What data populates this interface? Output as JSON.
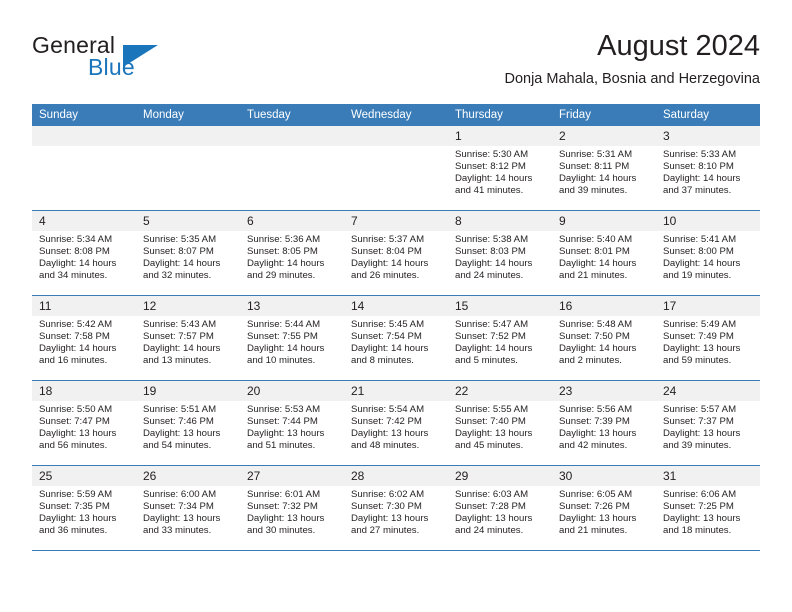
{
  "brand": {
    "word1": "General",
    "word2": "Blue",
    "accent_color": "#1b75bb"
  },
  "header": {
    "month_title": "August 2024",
    "location": "Donja Mahala, Bosnia and Herzegovina"
  },
  "calendar": {
    "header_color": "#3a7cb8",
    "weekdays": [
      "Sunday",
      "Monday",
      "Tuesday",
      "Wednesday",
      "Thursday",
      "Friday",
      "Saturday"
    ],
    "weeks": [
      [
        {
          "day": "",
          "sunrise": "",
          "sunset": "",
          "daylight": "",
          "empty": true
        },
        {
          "day": "",
          "sunrise": "",
          "sunset": "",
          "daylight": "",
          "empty": true
        },
        {
          "day": "",
          "sunrise": "",
          "sunset": "",
          "daylight": "",
          "empty": true
        },
        {
          "day": "",
          "sunrise": "",
          "sunset": "",
          "daylight": "",
          "empty": true
        },
        {
          "day": "1",
          "sunrise": "Sunrise: 5:30 AM",
          "sunset": "Sunset: 8:12 PM",
          "daylight": "Daylight: 14 hours and 41 minutes.",
          "empty": false
        },
        {
          "day": "2",
          "sunrise": "Sunrise: 5:31 AM",
          "sunset": "Sunset: 8:11 PM",
          "daylight": "Daylight: 14 hours and 39 minutes.",
          "empty": false
        },
        {
          "day": "3",
          "sunrise": "Sunrise: 5:33 AM",
          "sunset": "Sunset: 8:10 PM",
          "daylight": "Daylight: 14 hours and 37 minutes.",
          "empty": false
        }
      ],
      [
        {
          "day": "4",
          "sunrise": "Sunrise: 5:34 AM",
          "sunset": "Sunset: 8:08 PM",
          "daylight": "Daylight: 14 hours and 34 minutes.",
          "empty": false
        },
        {
          "day": "5",
          "sunrise": "Sunrise: 5:35 AM",
          "sunset": "Sunset: 8:07 PM",
          "daylight": "Daylight: 14 hours and 32 minutes.",
          "empty": false
        },
        {
          "day": "6",
          "sunrise": "Sunrise: 5:36 AM",
          "sunset": "Sunset: 8:05 PM",
          "daylight": "Daylight: 14 hours and 29 minutes.",
          "empty": false
        },
        {
          "day": "7",
          "sunrise": "Sunrise: 5:37 AM",
          "sunset": "Sunset: 8:04 PM",
          "daylight": "Daylight: 14 hours and 26 minutes.",
          "empty": false
        },
        {
          "day": "8",
          "sunrise": "Sunrise: 5:38 AM",
          "sunset": "Sunset: 8:03 PM",
          "daylight": "Daylight: 14 hours and 24 minutes.",
          "empty": false
        },
        {
          "day": "9",
          "sunrise": "Sunrise: 5:40 AM",
          "sunset": "Sunset: 8:01 PM",
          "daylight": "Daylight: 14 hours and 21 minutes.",
          "empty": false
        },
        {
          "day": "10",
          "sunrise": "Sunrise: 5:41 AM",
          "sunset": "Sunset: 8:00 PM",
          "daylight": "Daylight: 14 hours and 19 minutes.",
          "empty": false
        }
      ],
      [
        {
          "day": "11",
          "sunrise": "Sunrise: 5:42 AM",
          "sunset": "Sunset: 7:58 PM",
          "daylight": "Daylight: 14 hours and 16 minutes.",
          "empty": false
        },
        {
          "day": "12",
          "sunrise": "Sunrise: 5:43 AM",
          "sunset": "Sunset: 7:57 PM",
          "daylight": "Daylight: 14 hours and 13 minutes.",
          "empty": false
        },
        {
          "day": "13",
          "sunrise": "Sunrise: 5:44 AM",
          "sunset": "Sunset: 7:55 PM",
          "daylight": "Daylight: 14 hours and 10 minutes.",
          "empty": false
        },
        {
          "day": "14",
          "sunrise": "Sunrise: 5:45 AM",
          "sunset": "Sunset: 7:54 PM",
          "daylight": "Daylight: 14 hours and 8 minutes.",
          "empty": false
        },
        {
          "day": "15",
          "sunrise": "Sunrise: 5:47 AM",
          "sunset": "Sunset: 7:52 PM",
          "daylight": "Daylight: 14 hours and 5 minutes.",
          "empty": false
        },
        {
          "day": "16",
          "sunrise": "Sunrise: 5:48 AM",
          "sunset": "Sunset: 7:50 PM",
          "daylight": "Daylight: 14 hours and 2 minutes.",
          "empty": false
        },
        {
          "day": "17",
          "sunrise": "Sunrise: 5:49 AM",
          "sunset": "Sunset: 7:49 PM",
          "daylight": "Daylight: 13 hours and 59 minutes.",
          "empty": false
        }
      ],
      [
        {
          "day": "18",
          "sunrise": "Sunrise: 5:50 AM",
          "sunset": "Sunset: 7:47 PM",
          "daylight": "Daylight: 13 hours and 56 minutes.",
          "empty": false
        },
        {
          "day": "19",
          "sunrise": "Sunrise: 5:51 AM",
          "sunset": "Sunset: 7:46 PM",
          "daylight": "Daylight: 13 hours and 54 minutes.",
          "empty": false
        },
        {
          "day": "20",
          "sunrise": "Sunrise: 5:53 AM",
          "sunset": "Sunset: 7:44 PM",
          "daylight": "Daylight: 13 hours and 51 minutes.",
          "empty": false
        },
        {
          "day": "21",
          "sunrise": "Sunrise: 5:54 AM",
          "sunset": "Sunset: 7:42 PM",
          "daylight": "Daylight: 13 hours and 48 minutes.",
          "empty": false
        },
        {
          "day": "22",
          "sunrise": "Sunrise: 5:55 AM",
          "sunset": "Sunset: 7:40 PM",
          "daylight": "Daylight: 13 hours and 45 minutes.",
          "empty": false
        },
        {
          "day": "23",
          "sunrise": "Sunrise: 5:56 AM",
          "sunset": "Sunset: 7:39 PM",
          "daylight": "Daylight: 13 hours and 42 minutes.",
          "empty": false
        },
        {
          "day": "24",
          "sunrise": "Sunrise: 5:57 AM",
          "sunset": "Sunset: 7:37 PM",
          "daylight": "Daylight: 13 hours and 39 minutes.",
          "empty": false
        }
      ],
      [
        {
          "day": "25",
          "sunrise": "Sunrise: 5:59 AM",
          "sunset": "Sunset: 7:35 PM",
          "daylight": "Daylight: 13 hours and 36 minutes.",
          "empty": false
        },
        {
          "day": "26",
          "sunrise": "Sunrise: 6:00 AM",
          "sunset": "Sunset: 7:34 PM",
          "daylight": "Daylight: 13 hours and 33 minutes.",
          "empty": false
        },
        {
          "day": "27",
          "sunrise": "Sunrise: 6:01 AM",
          "sunset": "Sunset: 7:32 PM",
          "daylight": "Daylight: 13 hours and 30 minutes.",
          "empty": false
        },
        {
          "day": "28",
          "sunrise": "Sunrise: 6:02 AM",
          "sunset": "Sunset: 7:30 PM",
          "daylight": "Daylight: 13 hours and 27 minutes.",
          "empty": false
        },
        {
          "day": "29",
          "sunrise": "Sunrise: 6:03 AM",
          "sunset": "Sunset: 7:28 PM",
          "daylight": "Daylight: 13 hours and 24 minutes.",
          "empty": false
        },
        {
          "day": "30",
          "sunrise": "Sunrise: 6:05 AM",
          "sunset": "Sunset: 7:26 PM",
          "daylight": "Daylight: 13 hours and 21 minutes.",
          "empty": false
        },
        {
          "day": "31",
          "sunrise": "Sunrise: 6:06 AM",
          "sunset": "Sunset: 7:25 PM",
          "daylight": "Daylight: 13 hours and 18 minutes.",
          "empty": false
        }
      ]
    ]
  }
}
